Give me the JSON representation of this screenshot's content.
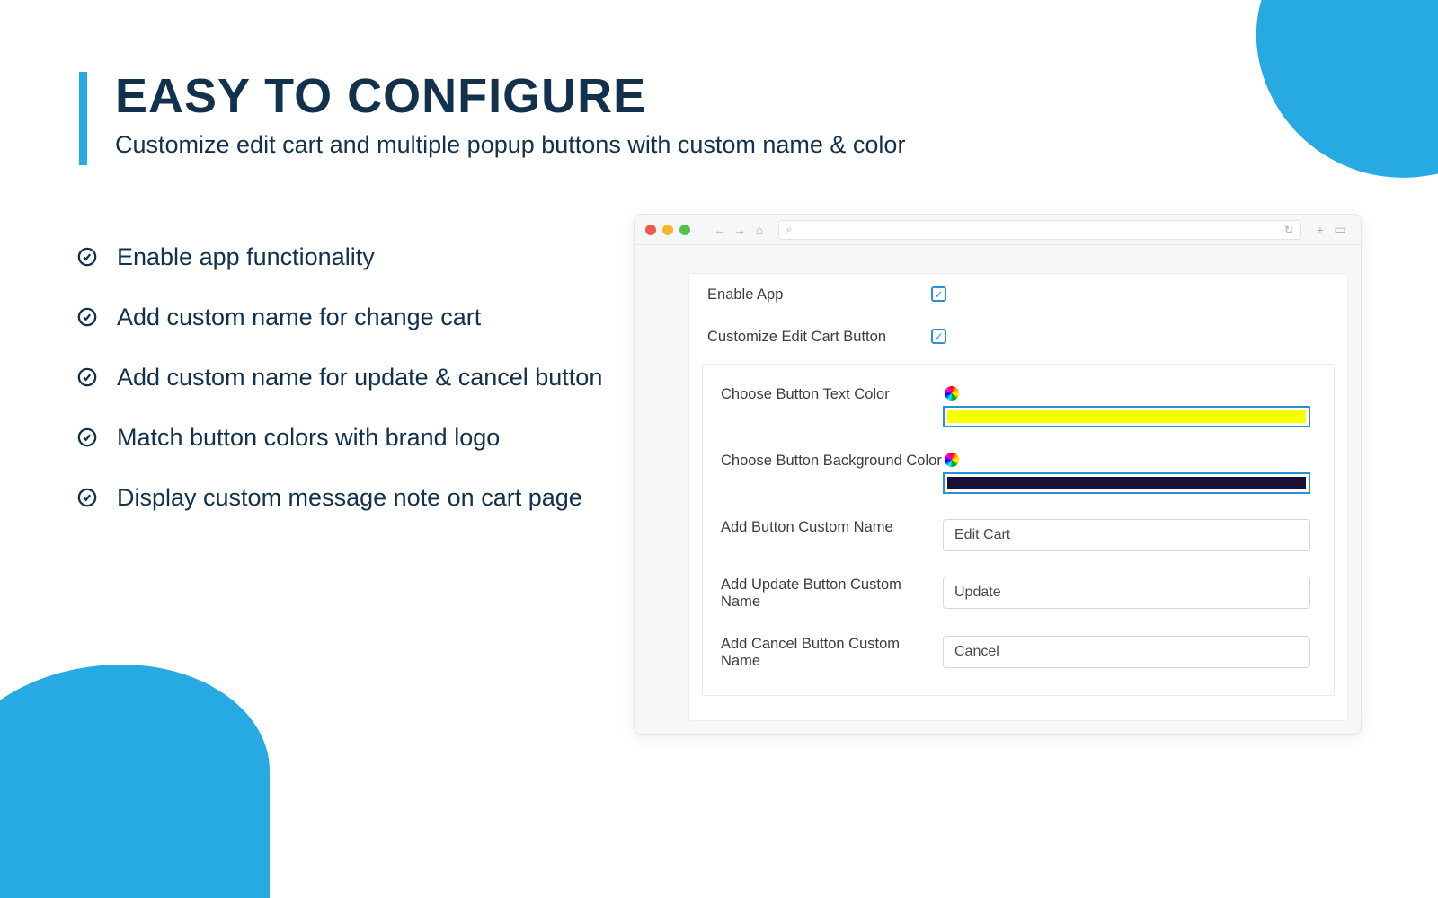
{
  "header": {
    "title": "EASY TO CONFIGURE",
    "subtitle": "Customize edit cart and multiple popup buttons with custom name & color"
  },
  "features": [
    "Enable app functionality",
    "Add custom name for change cart",
    "Add custom name for update & cancel button",
    "Match button colors with brand logo",
    "Display custom message note on cart page"
  ],
  "config": {
    "enable_app_label": "Enable App",
    "customize_label": "Customize Edit Cart Button",
    "text_color_label": "Choose Button Text Color",
    "bg_color_label": "Choose Button Background Color",
    "button_name_label": "Add Button Custom Name",
    "button_name_value": "Edit Cart",
    "update_name_label": "Add Update Button Custom Name",
    "update_name_value": "Update",
    "cancel_name_label": "Add Cancel Button Custom Name",
    "cancel_name_value": "Cancel",
    "text_color_value": "#f8ff00",
    "bg_color_value": "#1a1036"
  }
}
